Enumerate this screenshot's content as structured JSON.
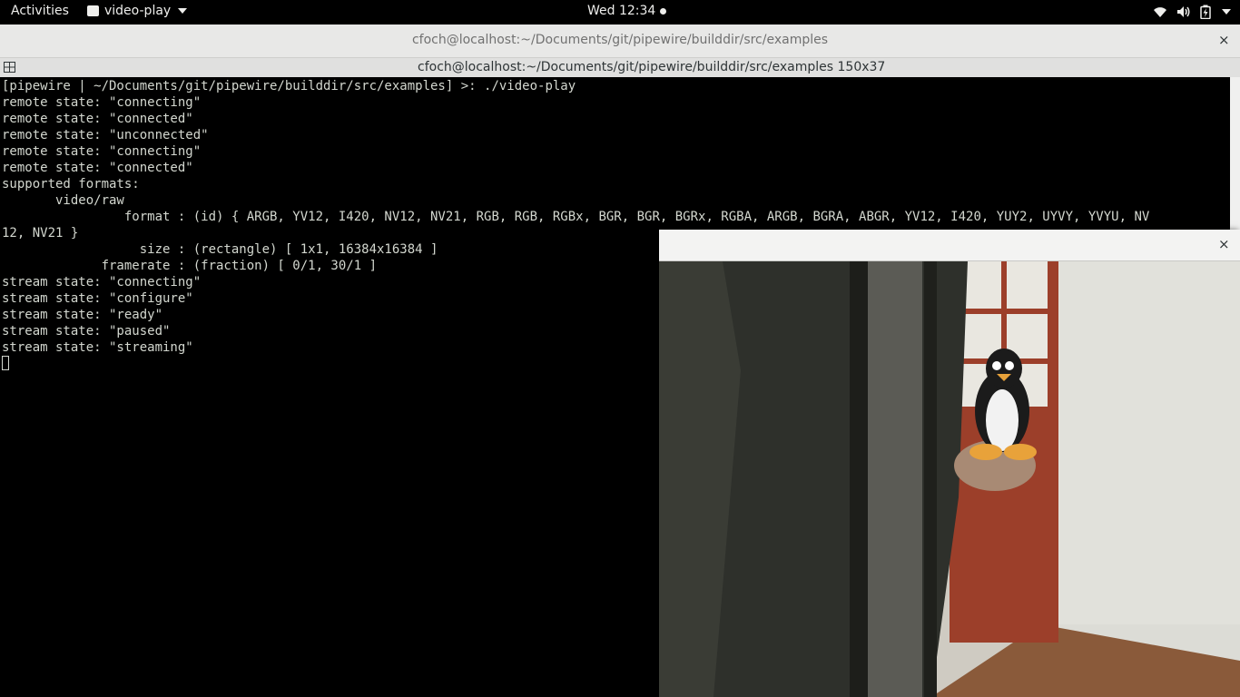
{
  "topbar": {
    "activities": "Activities",
    "app_name": "video-play",
    "clock": "Wed 12:34"
  },
  "terminal": {
    "window_title": "cfoch@localhost:~/Documents/git/pipewire/builddir/src/examples",
    "tab_title": "cfoch@localhost:~/Documents/git/pipewire/builddir/src/examples 150x37",
    "close_glyph": "×",
    "lines": [
      "[pipewire | ~/Documents/git/pipewire/builddir/src/examples] >: ./video-play",
      "remote state: \"connecting\"",
      "remote state: \"connected\"",
      "remote state: \"unconnected\"",
      "remote state: \"connecting\"",
      "remote state: \"connected\"",
      "supported formats:",
      "       video/raw",
      "                format : (id) { ARGB, YV12, I420, NV12, NV21, RGB, RGB, RGBx, BGR, BGR, BGRx, RGBA, ARGB, BGRA, ABGR, YV12, I420, YUY2, UYVY, YVYU, NV",
      "12, NV21 }",
      "                  size : (rectangle) [ 1x1, 16384x16384 ]",
      "             framerate : (fraction) [ 0/1, 30/1 ]",
      "stream state: \"connecting\"",
      "stream state: \"configure\"",
      "stream state: \"ready\"",
      "stream state: \"paused\"",
      "stream state: \"streaming\""
    ]
  },
  "video_window": {
    "close_glyph": "×"
  },
  "colors": {
    "topbar_bg": "#000000",
    "terminal_bg": "#000000",
    "terminal_fg": "#d3d7cf",
    "titlebar_bg": "#e8e8e7"
  },
  "icons": [
    "app-icon",
    "dropdown-arrow-icon",
    "wifi-icon",
    "volume-icon",
    "battery-icon",
    "terminal-menu-icon",
    "close-icon"
  ]
}
